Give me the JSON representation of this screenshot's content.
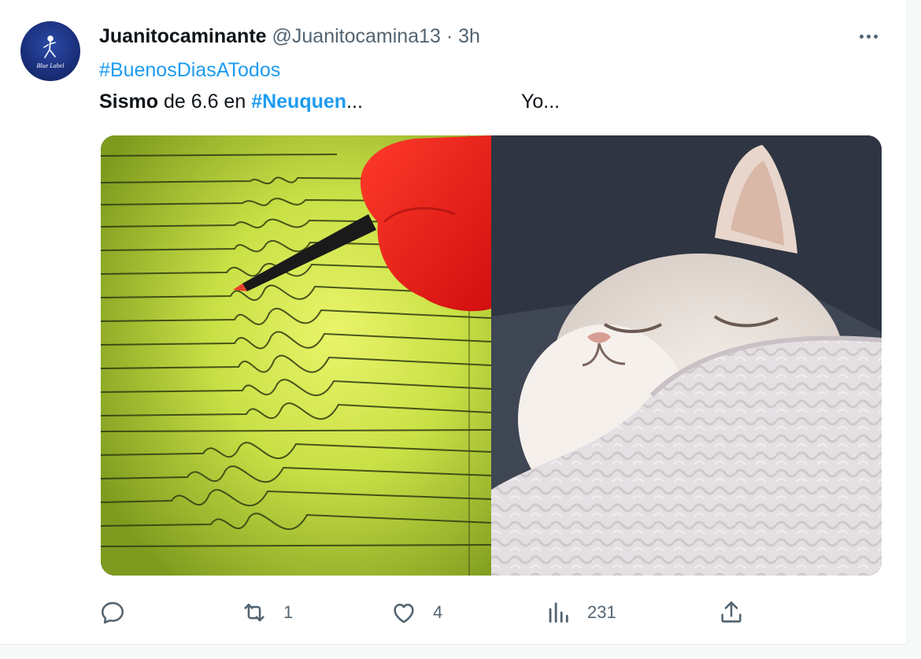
{
  "tweet": {
    "author_name": "Juanitocaminante",
    "author_handle": "@Juanitocamina13",
    "separator": "·",
    "time": "3h",
    "avatar_text": "Blue Label",
    "hashtag_line": "#BuenosDiasATodos",
    "text_bold": "Sismo",
    "text_mid": " de 6.6 en ",
    "text_tag": "#Neuquen",
    "text_ellipsis": "...",
    "text_right": "Yo...",
    "media": {
      "left_panel": "seismograph-with-red-gloved-hand-and-pen",
      "right_panel": "white-cat-sleeping-under-blanket"
    }
  },
  "actions": {
    "reply": {
      "icon": "reply-icon",
      "count": ""
    },
    "retweet": {
      "icon": "retweet-icon",
      "count": "1"
    },
    "like": {
      "icon": "heart-icon",
      "count": "4"
    },
    "views": {
      "icon": "bar-chart-icon",
      "count": "231"
    },
    "share": {
      "icon": "share-icon",
      "count": ""
    }
  },
  "colors": {
    "link": "#1d9bf0",
    "secondary_text": "#536471",
    "primary_text": "#0f1419",
    "avatar_bg": "#1a2f7a"
  }
}
